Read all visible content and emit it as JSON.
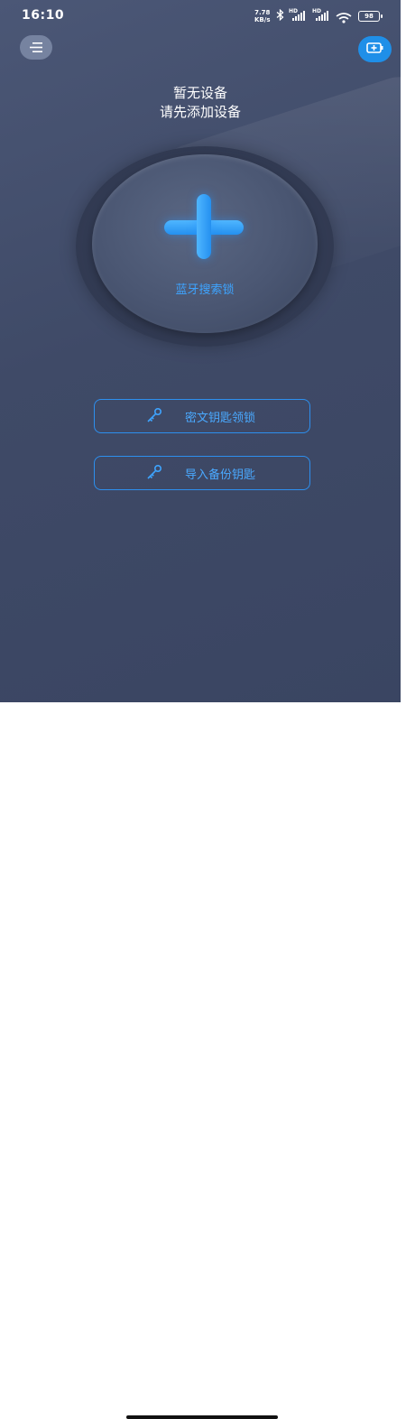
{
  "status_bar": {
    "time": "16:10",
    "net_speed_value": "7.78",
    "net_speed_unit": "KB/s",
    "signal_label": "HD",
    "battery": "98",
    "icons": [
      "bluetooth-icon",
      "signal-icon",
      "signal-icon",
      "wifi-icon",
      "battery-icon"
    ]
  },
  "header": {
    "menu_icon": "menu-icon",
    "add_device_icon": "add-device-icon"
  },
  "empty_state": {
    "line1": "暂无设备",
    "line2": "请先添加设备"
  },
  "bluetooth_search": {
    "icon": "plus-icon",
    "label": "蓝牙搜索锁"
  },
  "actions": [
    {
      "label": "密文钥匙领锁",
      "icon": "key-icon"
    },
    {
      "label": "导入备份钥匙",
      "icon": "key-icon"
    }
  ],
  "colors": {
    "background": "#434e6c",
    "accent": "#2d8fee",
    "menu_button": "#7683a0"
  }
}
